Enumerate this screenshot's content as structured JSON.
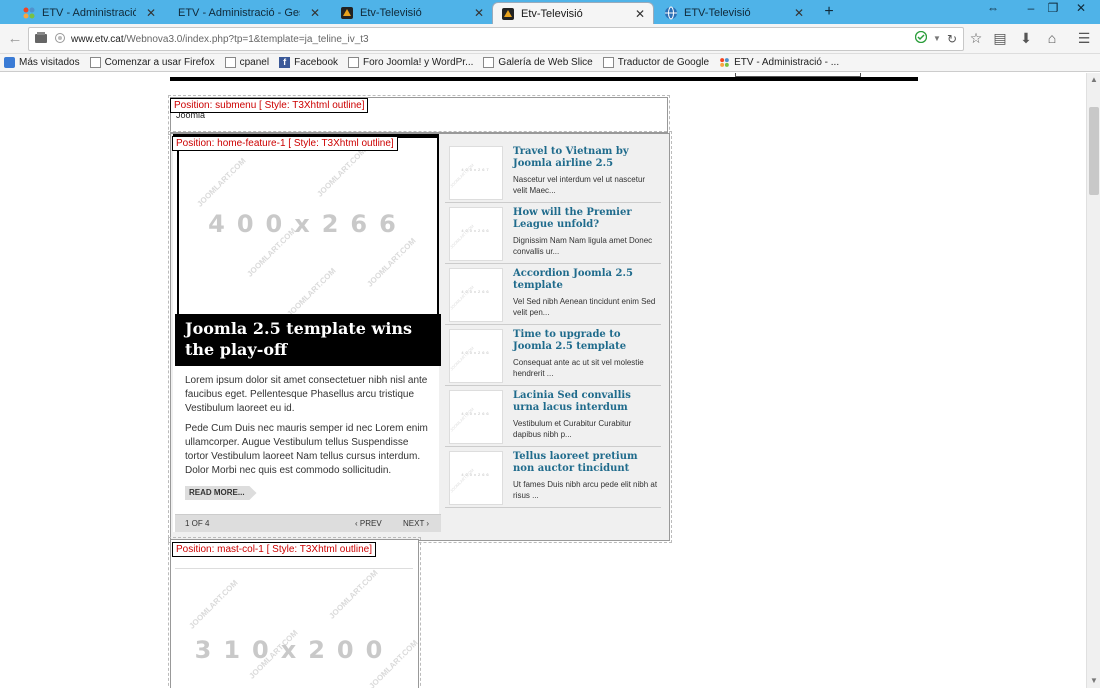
{
  "browser": {
    "tabs": [
      {
        "title": "ETV - Administració - Gest...",
        "active": false,
        "favicon": "joomla-icon"
      },
      {
        "title": "ETV - Administració - Gestor d...",
        "active": false,
        "favicon": "none"
      },
      {
        "title": "Etv-Televisió",
        "active": false,
        "favicon": "etv-icon"
      },
      {
        "title": "Etv-Televisió",
        "active": true,
        "favicon": "etv-icon"
      },
      {
        "title": "ETV-Televisió",
        "active": false,
        "favicon": "globe-icon"
      }
    ],
    "close_glyph": "✕",
    "new_tab_glyph": "+",
    "url_host": "www.etv.cat",
    "url_path": "/Webnova3.0/index.php?tp=1&template=ja_teline_iv_t3",
    "bookmarks": [
      {
        "label": "Más visitados",
        "icon": "bookmark-icon"
      },
      {
        "label": "Comenzar a usar Firefox",
        "icon": "page-icon"
      },
      {
        "label": "cpanel",
        "icon": "page-icon"
      },
      {
        "label": "Facebook",
        "icon": "facebook-icon"
      },
      {
        "label": "Foro Joomla! y WordPr...",
        "icon": "page-icon"
      },
      {
        "label": "Galería de Web Slice",
        "icon": "page-icon"
      },
      {
        "label": "Traductor de Google",
        "icon": "page-icon"
      },
      {
        "label": "ETV - Administració - ...",
        "icon": "joomla-icon"
      }
    ]
  },
  "page": {
    "submenu_label": "Position: submenu [ Style: T3Xhtml outline]",
    "submenu_peek": "Joomla",
    "feature_label": "Position: home-feature-1 [ Style: T3Xhtml outline]",
    "feature_image_dims": "400x266",
    "watermark": "JOOMLART.COM",
    "feature_title": "Joomla 2.5 template wins the play-off",
    "intro_p1": "Lorem ipsum dolor sit amet consectetuer nibh nisl ante faucibus eget. Pellentesque Phasellus arcu tristique Vestibulum laoreet eu id.",
    "intro_p2": "Pede Cum Duis nec mauris semper id nec Lorem enim ullamcorper. Augue Vestibulum tellus Suspendisse tortor Vestibulum laoreet Nam tellus cursus interdum. Dolor Morbi nec quis est commodo sollicitudin.",
    "read_more": "READ MORE...",
    "pager_count": "1 OF 4",
    "pager_prev": "‹ PREV",
    "pager_next": "NEXT ›",
    "items": [
      {
        "title": "Travel to Vietnam by Joomla airline 2.5",
        "desc": "Nascetur vel interdum vel ut nascetur velit Maec...",
        "thumb_dims": "400x267"
      },
      {
        "title": "How will the Premier League unfold?",
        "desc": "Dignissim Nam Nam ligula amet Donec convallis ur...",
        "thumb_dims": "400x266"
      },
      {
        "title": "Accordion Joomla 2.5 template",
        "desc": "Vel Sed nibh Aenean tincidunt enim Sed velit pen...",
        "thumb_dims": "400x266"
      },
      {
        "title": "Time to upgrade to Joomla 2.5 template",
        "desc": "Consequat ante ac ut sit vel molestie hendrerit ...",
        "thumb_dims": "400x266"
      },
      {
        "title": "Lacinia Sed convallis urna lacus interdum",
        "desc": "Vestibulum et Curabitur Curabitur dapibus nibh p...",
        "thumb_dims": "400x266"
      },
      {
        "title": "Tellus laoreet pretium non auctor tincidunt",
        "desc": "Ut fames Duis nibh arcu pede elit nibh at risus ...",
        "thumb_dims": "400x266"
      }
    ],
    "mast_label": "Position: mast-col-1 [ Style: T3Xhtml outline]",
    "mast_image_dims": "310x200"
  }
}
